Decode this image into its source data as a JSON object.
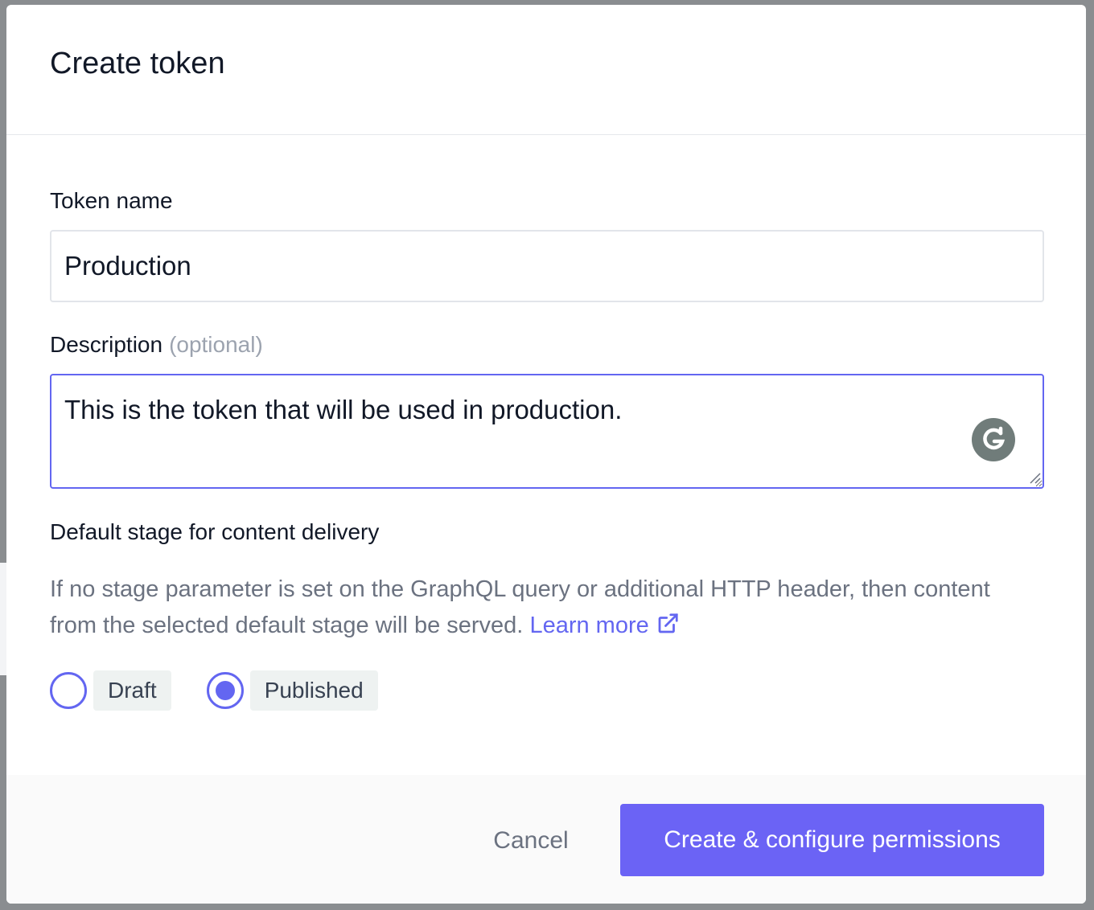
{
  "modal": {
    "title": "Create token"
  },
  "form": {
    "token_name_label": "Token name",
    "token_name_value": "Production",
    "description_label": "Description",
    "description_optional": "(optional)",
    "description_value": "This is the token that will be used in production."
  },
  "stage": {
    "heading": "Default stage for content delivery",
    "help_text": "If no stage parameter is set on the GraphQL query or additional HTTP header, then content from the selected default stage will be served.",
    "learn_more": "Learn more",
    "options": [
      {
        "label": "Draft",
        "selected": false
      },
      {
        "label": "Published",
        "selected": true
      }
    ]
  },
  "footer": {
    "cancel_label": "Cancel",
    "create_label": "Create & configure permissions"
  },
  "colors": {
    "accent": "#6366f1",
    "primary_button": "#6b63f5",
    "option_chip": "#eef2f1"
  },
  "icons": {
    "grammarly": "grammarly-icon",
    "external_link": "external-link-icon",
    "resize": "resize-handle-icon"
  }
}
